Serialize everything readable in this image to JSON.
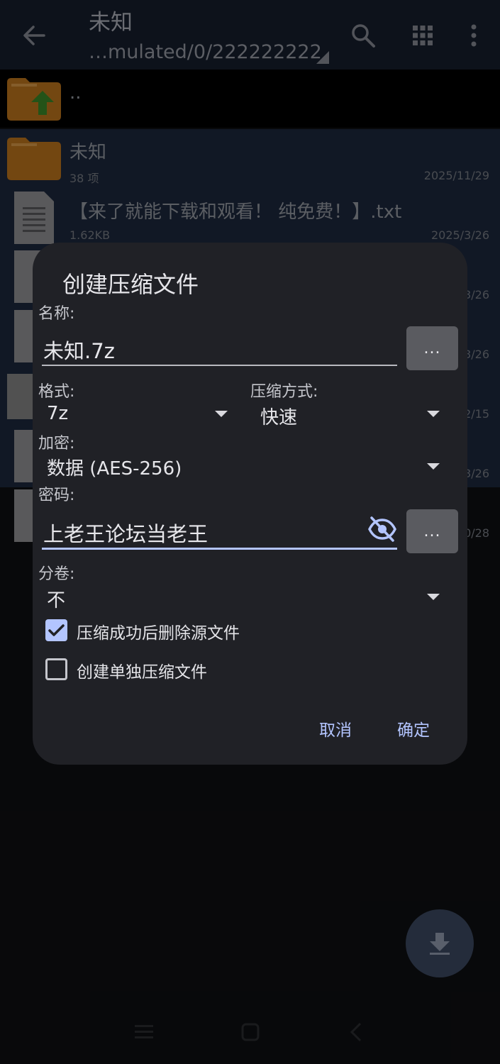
{
  "app_bar": {
    "title": "未知",
    "path": "…mulated/0/222222222"
  },
  "file_list": {
    "parent_label": "..",
    "items": [
      {
        "name": "未知",
        "sub": "38 项",
        "date": "2025/11/29",
        "type": "folder"
      },
      {
        "name": "【来了就能下载和观看！ 纯免费！】.txt",
        "sub": "1.62KB",
        "date": "2025/3/26",
        "type": "text"
      },
      {
        "date": "3/26"
      },
      {
        "date": "3/26"
      },
      {
        "date": "2/15"
      },
      {
        "date": "3/26"
      },
      {
        "date": "0/28"
      }
    ]
  },
  "dialog": {
    "title": "创建压缩文件",
    "name_label": "名称:",
    "name_value": "未知.7z",
    "browse_label": "...",
    "format_label": "格式:",
    "format_value": "7z",
    "method_label": "压缩方式:",
    "method_value": "快速",
    "encrypt_label": "加密:",
    "encrypt_value": "数据 (AES-256)",
    "password_label": "密码:",
    "password_value": "上老王论坛当老王",
    "password_more_label": "...",
    "split_label": "分卷:",
    "split_value": "不",
    "delete_source_label": "压缩成功后删除源文件",
    "delete_source_checked": true,
    "separate_archive_label": "创建单独压缩文件",
    "separate_archive_checked": false,
    "cancel_label": "取消",
    "ok_label": "确定"
  },
  "colors": {
    "accent": "#b3c5ff",
    "dialog_bg": "#202126",
    "topbar_bg": "#172030",
    "selected_row": "#1e2a40",
    "folder": "#c77a1e"
  }
}
